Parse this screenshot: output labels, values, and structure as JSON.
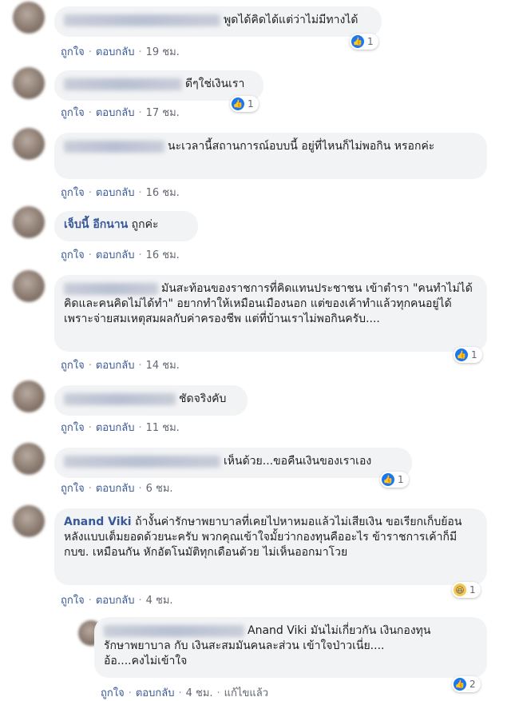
{
  "actions": {
    "like": "ถูกใจ",
    "reply": "ตอบกลับ",
    "edited": "แก้ไขแล้ว",
    "dot": "·"
  },
  "comments": [
    {
      "author": "",
      "text": "พูดได้คิดได้แต่ว่าไม่มีทางได้",
      "time": "19 ชม.",
      "reactions": "1",
      "reaction_icon": "like-icon"
    },
    {
      "author": "",
      "text": "ดีๆใช่เงินเรา",
      "time": "17 ชม.",
      "reactions": "1",
      "reaction_icon": "like-icon"
    },
    {
      "author": "",
      "text": "นะเวลานี้สถานการณ์อบบนี้ อยู่ที่ไหนก็ไม่พอกิน หรอกค่ะ",
      "time": "16 ชม."
    },
    {
      "author": "เจ็บนี้ อีกนาน",
      "text": "ถูกค่ะ",
      "time": "16 ชม."
    },
    {
      "author": "",
      "text": "มันสะท้อนของราชการที่คิดแทนประชาชน เข้าตำรา \"คนทำไม่ได้คิดและคนคิดไม่ได้ทำ\" อยากทำให้เหมือนเมืองนอก แต่ของเค้าทำแล้วทุกคนอยู่ได้เพราะจ่ายสมเหตุสมผลกับค่าครองชีพ แต่ที่บ้านเราไม่พอกินครับ....",
      "time": "14 ชม.",
      "reactions": "1",
      "reaction_icon": "like-icon"
    },
    {
      "author": "",
      "text": "ชัดจริงคับ",
      "time": "11 ชม."
    },
    {
      "author": "",
      "text": "เห็นด้วย...ขอคืนเงินของเราเอง",
      "time": "6 ชม.",
      "reactions": "1",
      "reaction_icon": "like-icon"
    },
    {
      "author": "Anand Viki",
      "text": "ถ้างั้นค่ารักษาพยาบาลที่เคยไปหาหมอแล้วไม่เสียเงิน ขอเรียกเก็บย้อนหลังแบบเต็มยอดด้วยนะครับ พวกคุณเข้าใจมั้ยว่ากองทุนคืออะไร ข้าราชการเค้าก็มีกบข. เหมือนกัน หักอัตโนมัติทุกเดือนด้วย ไม่เห็นออกมาโวย",
      "time": "4 ชม.",
      "reactions": "1",
      "reaction_icon": "haha-icon"
    }
  ],
  "reply": {
    "author": "",
    "text_lines": [
      "Anand Viki มันไม่เกี่ยวกัน เงินกองทุน",
      "รักษาพยาบาล กับ เงินสะสมมันคนละส่วน เข้าใจป่าวเนี่ย....",
      "อ้อ....คงไม่เข้าใจ"
    ],
    "time": "4 ชม.",
    "reactions": "2",
    "reaction_icon": "like-icon"
  }
}
